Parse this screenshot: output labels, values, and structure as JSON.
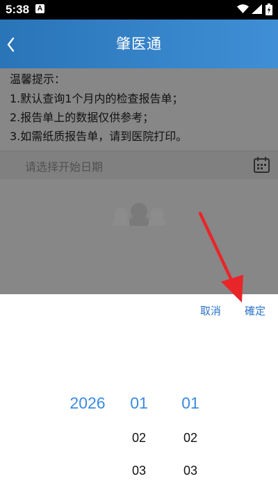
{
  "status_bar": {
    "time": "5:38",
    "app_icon_letter": "A"
  },
  "header": {
    "title": "肇医通",
    "back_icon": "chevron-left-icon",
    "background": "#3a86cf"
  },
  "notice": {
    "title": "温馨提示：",
    "lines": [
      "1.默认查询1个月内的检查报告单；",
      "2.报告单上的数据仅供参考；",
      "3.如需纸质报告单，请到医院打印。"
    ]
  },
  "date_filter": {
    "placeholder": "请选择开始日期",
    "icon": "calendar-icon"
  },
  "picker": {
    "cancel_label": "取消",
    "confirm_label": "確定",
    "accent_color": "#3b8ae0",
    "year": {
      "selected": "2026"
    },
    "month": {
      "selected": "01",
      "next": [
        "02",
        "03"
      ]
    },
    "day": {
      "selected": "01",
      "next": [
        "02",
        "03"
      ]
    }
  },
  "annotation": {
    "arrow_color": "#e8262a"
  }
}
